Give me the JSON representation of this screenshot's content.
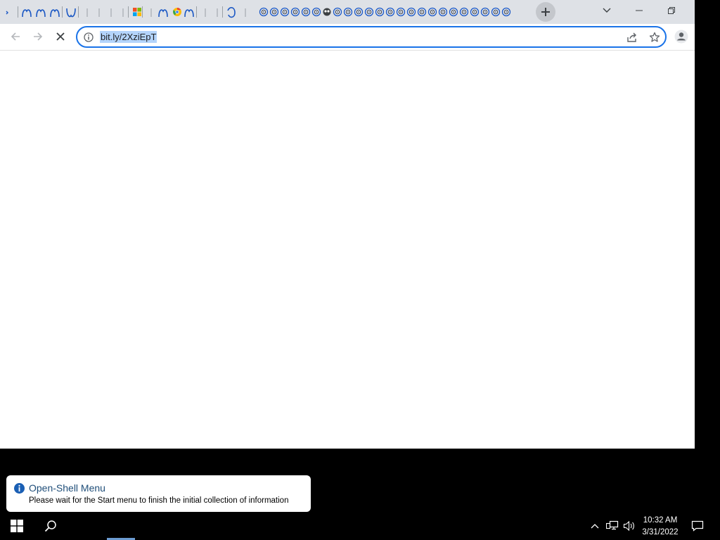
{
  "browser": {
    "tabs": [
      {
        "icon": "partial-tab-icon"
      },
      {
        "icon": "curly-n-icon"
      },
      {
        "icon": "curly-n-icon"
      },
      {
        "icon": "curly-n-icon"
      },
      {
        "icon": "curly-u-icon"
      },
      {
        "icon": "blank-tab-icon"
      },
      {
        "icon": "blank-tab-icon"
      },
      {
        "icon": "blank-tab-icon"
      },
      {
        "icon": "blank-tab-icon"
      },
      {
        "icon": "microsoft-logo-icon"
      },
      {
        "icon": "blank-tab-icon"
      },
      {
        "icon": "curly-n-icon"
      },
      {
        "icon": "chrome-logo-icon"
      },
      {
        "icon": "curly-n-icon"
      },
      {
        "icon": "blank-tab-icon"
      },
      {
        "icon": "blank-tab-icon"
      },
      {
        "icon": "curly-o-icon"
      },
      {
        "icon": "blank-tab-icon"
      }
    ],
    "spiral_tab_count": 24,
    "new_tab_button": "new-tab-plus-icon",
    "window_controls": [
      "tab-search-chevron-icon",
      "minimize-icon",
      "restore-icon"
    ],
    "address_bar": {
      "url": "bit.ly/2XziEpT",
      "site_info_icon": "info-icon",
      "share_icon": "share-icon",
      "bookmark_icon": "star-icon",
      "profile_icon": "profile-icon"
    },
    "navigation": [
      "back-arrow-icon",
      "forward-arrow-icon",
      "stop-loading-icon"
    ]
  },
  "notification": {
    "title": "Open-Shell Menu",
    "body": "Please wait for the Start menu to finish the initial collection of information"
  },
  "taskbar": {
    "time": "10:32 AM",
    "date": "3/31/2022"
  },
  "colors": {
    "accent": "#1a73e8",
    "tabstrip": "#dee1e6",
    "tab_icon_blue": "#1a57c4",
    "selection": "#b4d4fb"
  }
}
